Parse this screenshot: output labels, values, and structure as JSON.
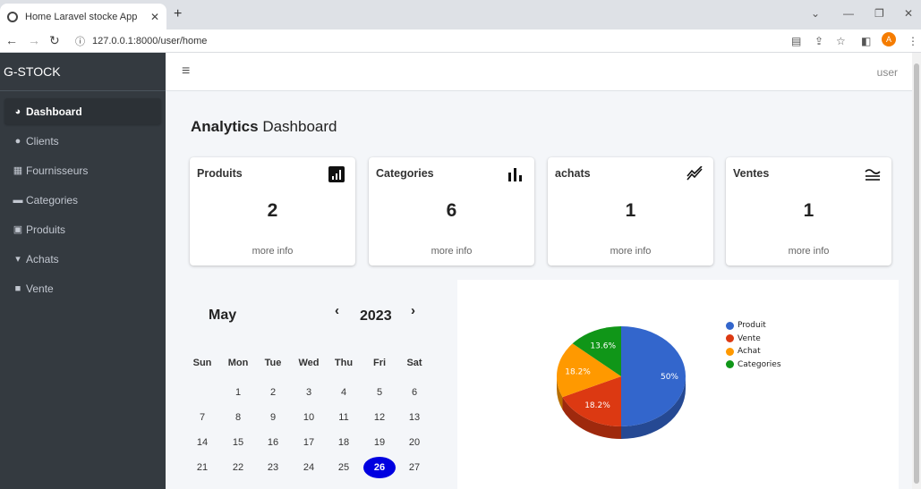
{
  "browser": {
    "tab_title": "Home Laravel stocke App",
    "url": "127.0.0.1:8000/user/home"
  },
  "sidebar": {
    "brand": "G-STOCK",
    "items": [
      {
        "label": "Dashboard",
        "icon": "dashboard-icon",
        "active": true
      },
      {
        "label": "Clients",
        "icon": "user-icon"
      },
      {
        "label": "Fournisseurs",
        "icon": "building-icon"
      },
      {
        "label": "Categories",
        "icon": "folder-icon"
      },
      {
        "label": "Produits",
        "icon": "gift-icon"
      },
      {
        "label": "Achats",
        "icon": "cart-icon"
      },
      {
        "label": "Vente",
        "icon": "truck-icon"
      }
    ]
  },
  "topnav": {
    "user": "user"
  },
  "page": {
    "title_bold": "Analytics",
    "title_rest": " Dashboard"
  },
  "cards": [
    {
      "title": "Produits",
      "value": "2",
      "more": "more info",
      "icon": "bar-chart-square-icon"
    },
    {
      "title": "Categories",
      "value": "6",
      "more": "more info",
      "icon": "bar-chart-icon"
    },
    {
      "title": "achats",
      "value": "1",
      "more": "more info",
      "icon": "trend-line-icon"
    },
    {
      "title": "Ventes",
      "value": "1",
      "more": "more info",
      "icon": "wave-lines-icon"
    }
  ],
  "calendar": {
    "month": "May",
    "year": "2023",
    "prev": "‹",
    "next": "›",
    "weekdays": [
      "Sun",
      "Mon",
      "Tue",
      "Wed",
      "Thu",
      "Fri",
      "Sat"
    ],
    "weeks": [
      [
        "",
        "1",
        "2",
        "3",
        "4",
        "5",
        "6"
      ],
      [
        "7",
        "8",
        "9",
        "10",
        "11",
        "12",
        "13"
      ],
      [
        "14",
        "15",
        "16",
        "17",
        "18",
        "19",
        "20"
      ],
      [
        "21",
        "22",
        "23",
        "24",
        "25",
        "26",
        "27"
      ]
    ],
    "today": "26"
  },
  "chart_data": {
    "type": "pie",
    "categories": [
      "Produit",
      "Vente",
      "Achat",
      "Categories"
    ],
    "values": [
      50,
      18.2,
      18.2,
      13.6
    ],
    "labels": [
      "50%",
      "18.2%",
      "18.2%",
      "13.6%"
    ],
    "colors": [
      "#3366cc",
      "#dc3912",
      "#ff9900",
      "#109618"
    ],
    "legend": "right"
  }
}
